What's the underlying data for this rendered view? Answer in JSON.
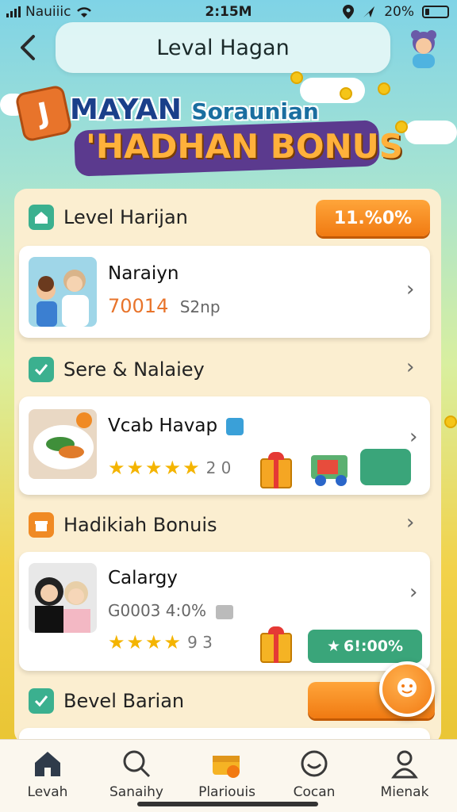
{
  "status_bar": {
    "carrier": "Nauiiic",
    "time": "2:15M",
    "battery": "20%",
    "battery_level": 0.2
  },
  "header": {
    "title": "Leval Hagan"
  },
  "banner": {
    "line1": "MAYAN",
    "line1_small": "Soraunian",
    "line2": "'HADHAN BONUS",
    "badge": "J"
  },
  "sections": [
    {
      "title": "Level Harijan",
      "pill": "11.%0%",
      "card": {
        "title": "Naraiyn",
        "value": "70014",
        "sub": "S2np"
      }
    },
    {
      "title": "Sere & Nalaiey",
      "card": {
        "title": "Vcab Havap",
        "stars": 5,
        "rating_text": "2 0"
      }
    },
    {
      "title": "Hadikiah Bonuis",
      "card": {
        "title": "Calargy",
        "sub": "G0003 4:0%",
        "stars": 4,
        "rating_text": "9 3",
        "button": "6!:00%"
      }
    },
    {
      "title": "Bevel Barian"
    }
  ],
  "nav": [
    {
      "label": "Levah",
      "icon": "home-icon"
    },
    {
      "label": "Sanaihy",
      "icon": "search-heart-icon"
    },
    {
      "label": "Plariouis",
      "icon": "treasure-icon"
    },
    {
      "label": "Cocan",
      "icon": "tray-icon"
    },
    {
      "label": "Mienak",
      "icon": "profile-icon"
    }
  ],
  "colors": {
    "accent_orange": "#f07a12",
    "teal": "#3aa57a",
    "panel": "#fbeed0"
  }
}
